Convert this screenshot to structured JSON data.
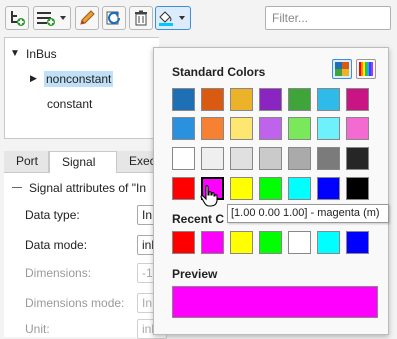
{
  "toolbar": {
    "filter_placeholder": "Filter...",
    "buttons": [
      "add-bus-element-icon",
      "add-bus-element-menu-icon",
      "edit-icon",
      "refresh-icon",
      "delete-icon",
      "fill-color-icon"
    ]
  },
  "tree": {
    "root": "InBus",
    "items": [
      "nonconstant",
      "constant"
    ],
    "selected": "nonconstant"
  },
  "tabs": [
    "Port",
    "Signal",
    "Exec"
  ],
  "active_tab": "Signal",
  "section_title": "Signal attributes of \"In",
  "properties": [
    {
      "label": "Data type:",
      "value": "In",
      "enabled": true
    },
    {
      "label": "Data mode:",
      "value": "inh",
      "enabled": true
    },
    {
      "label": "Dimensions:",
      "value": "-1",
      "enabled": false
    },
    {
      "label": "Dimensions mode:",
      "value": "In",
      "enabled": false
    },
    {
      "label": "Unit:",
      "value": "",
      "enabled": false
    },
    {
      "label": "",
      "value": "inh",
      "enabled": false
    }
  ],
  "color_picker": {
    "standard_title": "Standard Colors",
    "recent_title": "Recent C",
    "preview_title": "Preview",
    "standard_colors": [
      [
        "#1f6fb5",
        "#d95b12",
        "#ecb22a",
        "#8a25c2",
        "#3fa43a",
        "#2fbbe9",
        "#c81583"
      ],
      [
        "#2a91df",
        "#f68132",
        "#fde770",
        "#bf63ed",
        "#79e85b",
        "#6ff1fb",
        "#f36ad0"
      ],
      [
        "#ffffff",
        "#efefef",
        "#e0e0e0",
        "#cacaca",
        "#aaaaaa",
        "#7b7b7b",
        "#262626"
      ],
      [
        "#ff0000",
        "#ff00ff",
        "#ffff00",
        "#00ff00",
        "#00ffff",
        "#0000ff",
        "#000000"
      ]
    ],
    "recent_colors": [
      "#ff0000",
      "#ff00ff",
      "#ffff00",
      "#00ff00",
      "#ffffff",
      "#00ffff",
      "#0000ff"
    ],
    "hovered_color": "#ff00ff",
    "preview_color": "#ff00ff",
    "tooltip": "[1.00 0.00 1.00] - magenta (m)"
  }
}
